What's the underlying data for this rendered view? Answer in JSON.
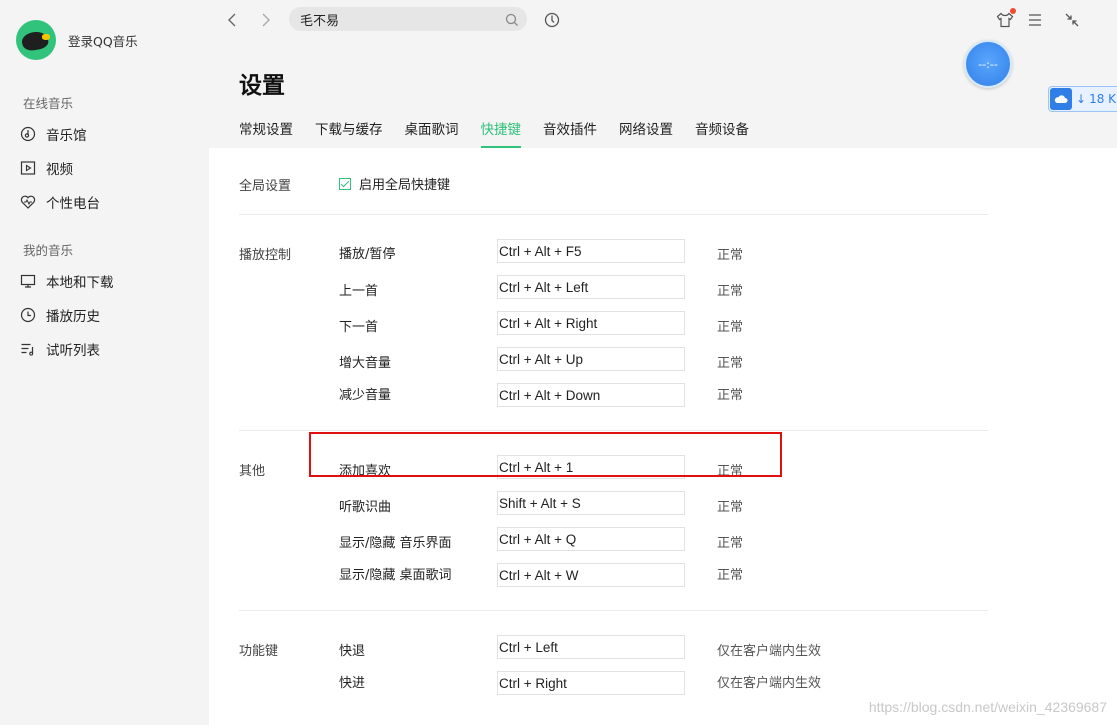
{
  "sidebar": {
    "login_text": "登录QQ音乐",
    "section_online": "在线音乐",
    "online_items": [
      {
        "label": "音乐馆",
        "icon": "music-hall-icon"
      },
      {
        "label": "视频",
        "icon": "video-icon"
      },
      {
        "label": "个性电台",
        "icon": "radio-icon"
      }
    ],
    "section_my": "我的音乐",
    "my_items": [
      {
        "label": "本地和下载",
        "icon": "monitor-icon"
      },
      {
        "label": "播放历史",
        "icon": "clock-icon"
      },
      {
        "label": "试听列表",
        "icon": "playlist-icon"
      }
    ]
  },
  "topbar": {
    "search_value": "毛不易"
  },
  "badges": {
    "timer_text": "--:--",
    "download_speed": "18 K"
  },
  "page": {
    "title": "设置",
    "tabs": [
      "常规设置",
      "下载与缓存",
      "桌面歌词",
      "快捷键",
      "音效插件",
      "网络设置",
      "音频设备"
    ],
    "active_tab": "快捷键"
  },
  "global": {
    "label": "全局设置",
    "checkbox_label": "启用全局快捷键",
    "checked": true
  },
  "groups": [
    {
      "label": "播放控制",
      "rows": [
        {
          "name": "播放/暂停",
          "key": "Ctrl + Alt + F5",
          "status": "正常"
        },
        {
          "name": "上一首",
          "key": "Ctrl + Alt + Left",
          "status": "正常"
        },
        {
          "name": "下一首",
          "key": "Ctrl + Alt + Right",
          "status": "正常"
        },
        {
          "name": "增大音量",
          "key": "Ctrl + Alt + Up",
          "status": "正常"
        },
        {
          "name": "减少音量",
          "key": "Ctrl + Alt + Down",
          "status": "正常"
        }
      ]
    },
    {
      "label": "其他",
      "rows": [
        {
          "name": "添加喜欢",
          "key": "Ctrl + Alt + 1",
          "status": "正常"
        },
        {
          "name": "听歌识曲",
          "key": "Shift + Alt + S",
          "status": "正常"
        },
        {
          "name": "显示/隐藏 音乐界面",
          "key": "Ctrl + Alt + Q",
          "status": "正常"
        },
        {
          "name": "显示/隐藏 桌面歌词",
          "key": "Ctrl + Alt + W",
          "status": "正常"
        }
      ]
    },
    {
      "label": "功能键",
      "rows": [
        {
          "name": "快退",
          "key": "Ctrl + Left",
          "status": "仅在客户端内生效"
        },
        {
          "name": "快进",
          "key": "Ctrl + Right",
          "status": "仅在客户端内生效"
        }
      ]
    }
  ],
  "watermark": "https://blog.csdn.net/weixin_42369687",
  "colors": {
    "accent": "#31c27c",
    "highlight": "#e01010",
    "sidebar_bg": "#f4f4f4"
  }
}
